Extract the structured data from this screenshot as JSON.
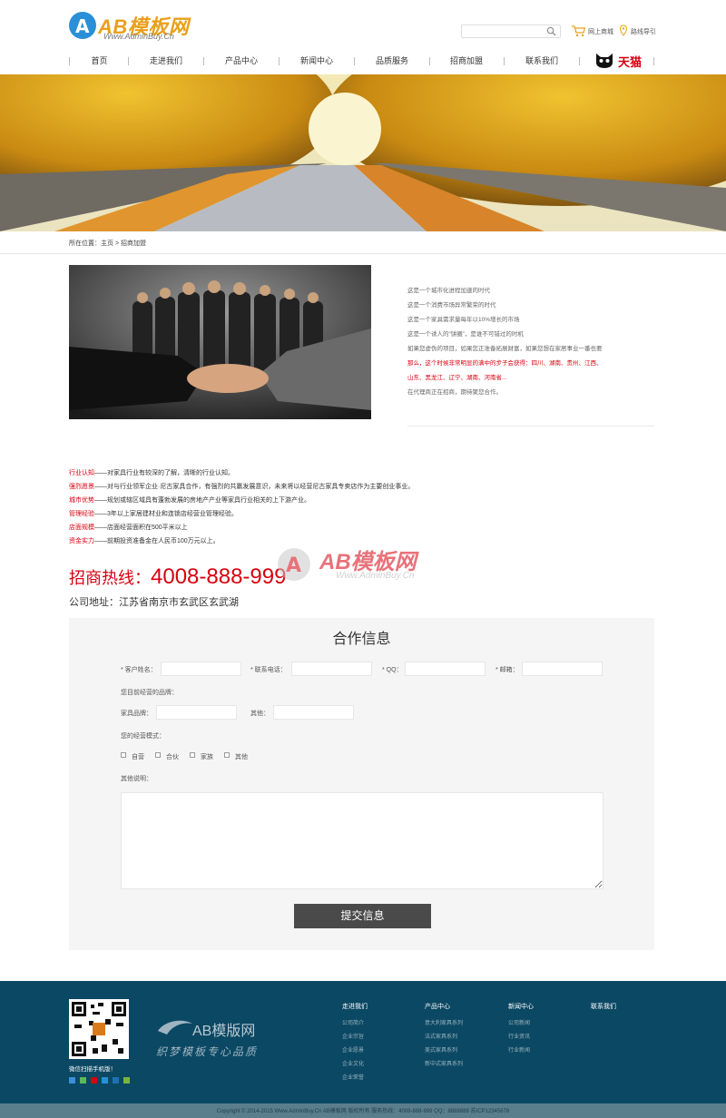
{
  "header": {
    "logo_text": "AB模板网",
    "logo_sub": "Www.AdminBuy.Cn",
    "search_placeholder": "",
    "shop_link": "网上商城",
    "nav_link": "路线导引",
    "tmall_label": "天猫"
  },
  "nav": [
    "首页",
    "走进我们",
    "产品中心",
    "新闻中心",
    "品质服务",
    "招商加盟",
    "联系我们"
  ],
  "breadcrumb": "所在位置：主页 > 招商加盟",
  "intro": {
    "lines": [
      "这是一个城市化进程加速的时代",
      "这是一个消费市场异常繁荣的时代",
      "这是一个家具需求量每年以10%增长的市场",
      "这是一个诱人的“饼圈”，是谁不可错过的时机",
      "如果您虚伪的项目，如果您正准备拓展财富，如果您想在家居事业一番也要",
      "那么，这个时候非常明显的满中的步子会获得：四川、湖南、贵州、江西、",
      "山东、黑龙江、辽宁、湖南、河南省...",
      "在代理商正在招商，期待聚您合作。"
    ]
  },
  "facts": [
    {
      "key": "行业认知",
      "text": "——对家具行业有较深的了解，清晰的行业认知。"
    },
    {
      "key": "强烈愿景",
      "text": "——对与行业领军企业·尼古家具合作，有强烈的共赢发展意识，未来将以经营尼古家具专卖店作为主要创业事业。"
    },
    {
      "key": "城市优势",
      "text": "——规划或辖区域具有蓬勃发展的房地产产业等家具行业相关的上下游产业。"
    },
    {
      "key": "管理经验",
      "text": "——3年以上家居建材业和连锁店经营业管理经验。"
    },
    {
      "key": "店面规模",
      "text": "——店面经营面积在500平米以上"
    },
    {
      "key": "资金实力",
      "text": "——前期投资准备金在人民币100万元以上。"
    }
  ],
  "hotline_label": "招商热线：",
  "hotline_number": "4008-888-999",
  "address": "公司地址：江苏省南京市玄武区玄武湖",
  "watermark": "AB模板网",
  "watermark_sub": "Www.AdminBuy.Cn",
  "form": {
    "title": "合作信息",
    "name_label": "* 客户姓名：",
    "phone_label": "* 联系电话：",
    "qq_label": "* QQ：",
    "email_label": "* 邮箱：",
    "brand_q": "您目前经营的品牌：",
    "brand_label": "家具品牌：",
    "other_label": "其他：",
    "mode_q": "您的经营模式：",
    "modes": [
      "自营",
      "合伙",
      "家族",
      "其他"
    ],
    "remark_label": "其他说明：",
    "submit": "提交信息"
  },
  "footer": {
    "qr_caption": "微信扫描手机版！",
    "logo_text": "AB模版网",
    "slogan": "织梦模板专心品质",
    "cols": [
      {
        "title": "走进我们",
        "links": [
          "公司简介",
          "企业宗旨",
          "企业愿景",
          "企业文化",
          "企业荣誉"
        ]
      },
      {
        "title": "产品中心",
        "links": [
          "意大利家具系列",
          "法式家具系列",
          "美式家具系列",
          "新中式家具系列"
        ]
      },
      {
        "title": "新闻中心",
        "links": [
          "公司新闻",
          "行业资讯",
          "行业新闻"
        ]
      },
      {
        "title": "联系我们",
        "links": []
      }
    ],
    "copyright": "Copyright © 2014-2015 Www.AdminBuy.Cn AB模板网 版权所有    服务热线：4008-888-999    QQ：8888888    苏ICP12345678"
  },
  "colors": {
    "accent": "#d7000f",
    "footer": "#0b4863",
    "logo": "#e9a01b"
  }
}
